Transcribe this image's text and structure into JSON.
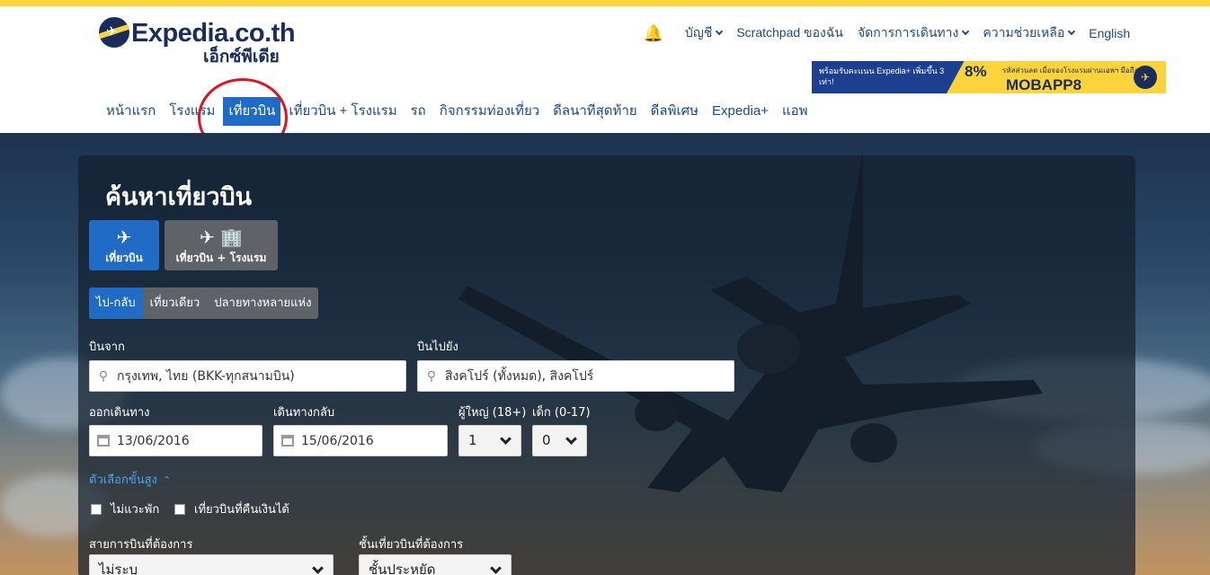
{
  "header": {
    "logo_word": "Expedia.co.th",
    "logo_thai": "เอ็กซ์พีเดีย",
    "top_nav": [
      {
        "label": "บัญชี",
        "has_dropdown": true
      },
      {
        "label": "Scratchpad ของฉัน",
        "has_dropdown": false
      },
      {
        "label": "จัดการการเดินทาง",
        "has_dropdown": true
      },
      {
        "label": "ความช่วยเหลือ",
        "has_dropdown": true
      },
      {
        "label": "English",
        "has_dropdown": false
      }
    ],
    "banner": {
      "left_text": "พร้อมรับคะแนน Expedia+ เพิ่มขึ้น 3 เท่า!",
      "discount": "8%",
      "sub_text": "รหัสส่วนลด เมื่อจองโรงแรมผ่านแอพฯ มือถือ",
      "code": "MOBAPP8"
    },
    "main_nav": [
      {
        "label": "หน้าแรก",
        "active": false
      },
      {
        "label": "โรงแรม",
        "active": false
      },
      {
        "label": "เที่ยวบิน",
        "active": true
      },
      {
        "label": "เที่ยวบิน + โรงแรม",
        "active": false
      },
      {
        "label": "รถ",
        "active": false
      },
      {
        "label": "กิจกรรมท่องเที่ยว",
        "active": false
      },
      {
        "label": "ดีลนาทีสุดท้าย",
        "active": false
      },
      {
        "label": "ดีลพิเศษ",
        "active": false
      },
      {
        "label": "Expedia+",
        "active": false
      },
      {
        "label": "แอพ",
        "active": false
      }
    ]
  },
  "search": {
    "title": "ค้นหาเที่ยวบิน",
    "product_tabs": [
      {
        "label": "เที่ยวบิน",
        "active": true
      },
      {
        "label": "เที่ยวบิน + โรงแรม",
        "active": false
      }
    ],
    "trip_types": [
      {
        "label": "ไป-กลับ",
        "active": true
      },
      {
        "label": "เที่ยวเดียว",
        "active": false
      },
      {
        "label": "ปลายทางหลายแห่ง",
        "active": false
      }
    ],
    "origin_label": "บินจาก",
    "origin_value": "กรุงเทพ, ไทย (BKK-ทุกสนามบิน)",
    "destination_label": "บินไปยัง",
    "destination_value": "สิงคโปร์ (ทั้งหมด), สิงคโปร์",
    "depart_label": "ออกเดินทาง",
    "depart_value": "13/06/2016",
    "return_label": "เดินทางกลับ",
    "return_value": "15/06/2016",
    "adults_label": "ผู้ใหญ่ (18+)",
    "adults_value": "1",
    "children_label": "เด็ก (0-17)",
    "children_value": "0",
    "advanced_label": "ตัวเลือกขั้นสูง",
    "nonstop_label": "ไม่แวะพัก",
    "refundable_label": "เที่ยวบินที่คืนเงินได้",
    "airline_label": "สายการบินที่ต้องการ",
    "airline_value": "ไม่ระบุ",
    "class_label": "ชั้นเที่ยวบินที่ต้องการ",
    "class_value": "ชั้นประหยัด"
  },
  "colors": {
    "accent": "#1f6bc6",
    "brand_navy": "#1a2c5b",
    "brand_yellow": "#fcd33a",
    "highlight_circle": "#e0141e"
  }
}
